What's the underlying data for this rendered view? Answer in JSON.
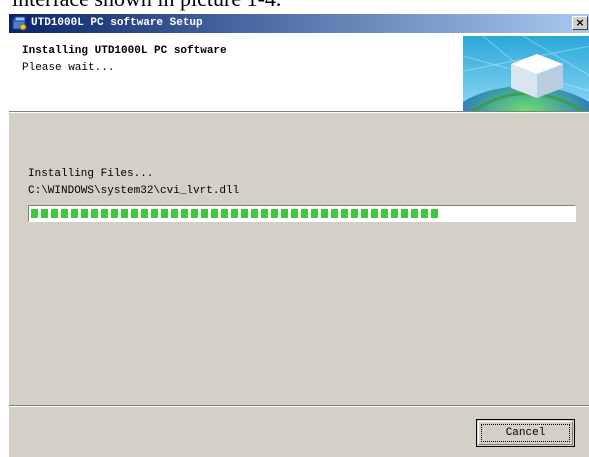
{
  "document": {
    "caption": "interface shown in picture 1-4."
  },
  "window": {
    "title": "UTD1000L PC software Setup",
    "close_glyph": "×"
  },
  "header": {
    "title": "Installing UTD1000L PC software",
    "subtitle": "Please wait..."
  },
  "status": {
    "action": "Installing Files...",
    "file": "C:\\WINDOWS\\system32\\cvi_lvrt.dll"
  },
  "progress": {
    "fraction": 0.77,
    "color": "#3cc83c"
  },
  "buttons": {
    "cancel": "Cancel"
  },
  "icons": {
    "app": "setup-icon",
    "header": "globe-cube-icon"
  }
}
